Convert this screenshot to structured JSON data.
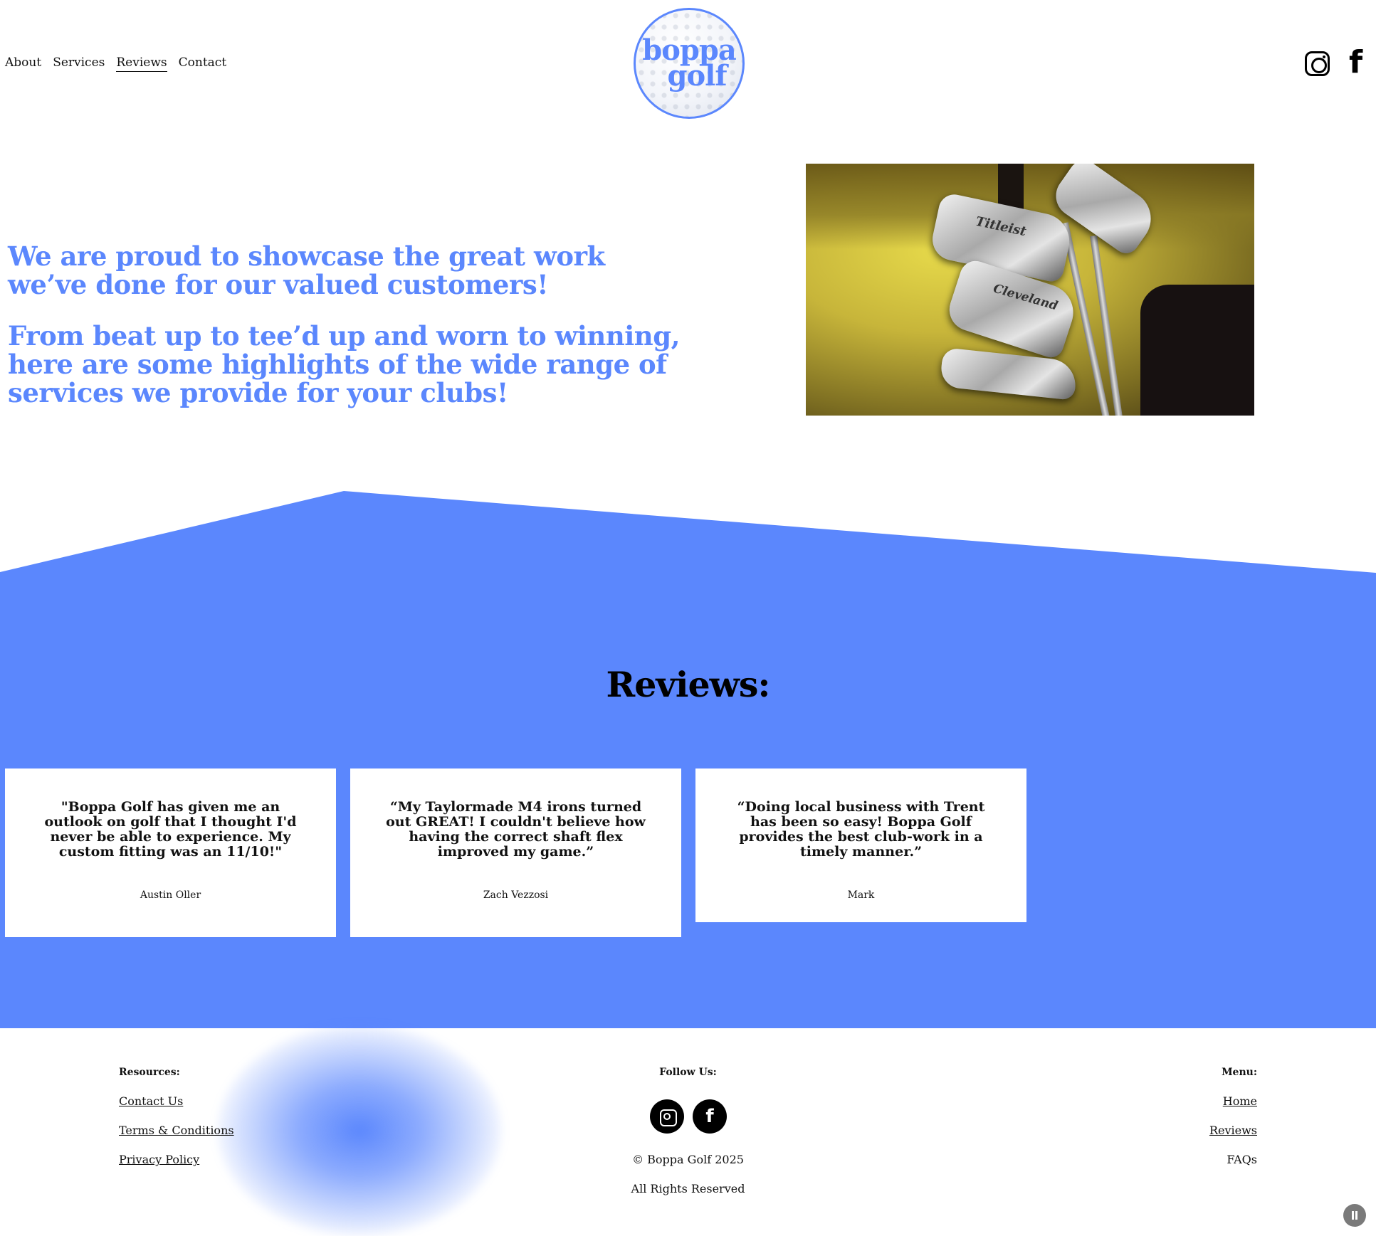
{
  "header": {
    "nav": [
      {
        "label": "About"
      },
      {
        "label": "Services"
      },
      {
        "label": "Reviews",
        "active": true
      },
      {
        "label": "Contact"
      }
    ],
    "logo": {
      "line1": "boppa",
      "line2": "golf"
    },
    "social": {
      "instagram_icon": "instagram-icon",
      "facebook_glyph": "f"
    }
  },
  "intro": {
    "paragraph1": "We are proud to showcase the great work we’ve done for our valued customers!",
    "paragraph2": "From beat up to tee’d up and worn to winning, here are some highlights of the wide range of services we provide for your clubs!"
  },
  "photo": {
    "brand1": "Titleist",
    "brand2": "Cleveland"
  },
  "reviews": {
    "title": "Reviews:",
    "items": [
      {
        "quote": "\"Boppa Golf has given me an outlook on golf that I thought I'd never be able to experience. My custom fitting was an 11/10!\"",
        "author": "Austin Oller"
      },
      {
        "quote": "“My Taylormade M4 irons turned out GREAT! I couldn't believe how having the correct shaft flex improved my game.”",
        "author": "Zach Vezzosi"
      },
      {
        "quote": "“Doing local business with Trent has been so easy! Boppa Golf provides the best club-work in a timely manner.”",
        "author": "Mark"
      }
    ]
  },
  "footer": {
    "resources": {
      "heading": "Resources:",
      "links": [
        "Contact Us",
        "Terms & Conditions",
        "Privacy Policy"
      ]
    },
    "follow": {
      "heading": "Follow Us:",
      "facebook_glyph": "f",
      "copyright": "© Boppa Golf 2025",
      "rights": "All Rights Reserved"
    },
    "menu": {
      "heading": "Menu:",
      "links": [
        "Home",
        "Reviews"
      ],
      "plain": "FAQs"
    }
  },
  "colors": {
    "accent": "#5b87fd",
    "text": "#111111",
    "background": "#ffffff"
  }
}
